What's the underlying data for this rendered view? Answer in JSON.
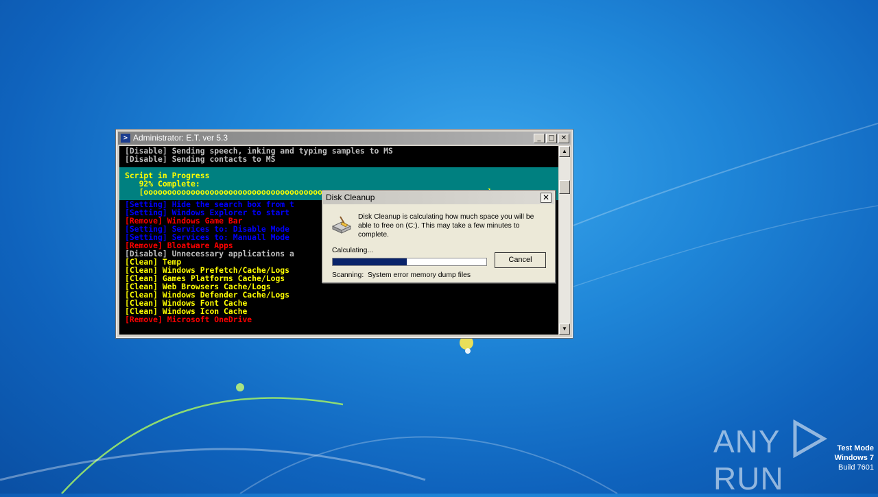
{
  "console": {
    "title": "Administrator: E.T. ver 5.3",
    "icon": "powershell-icon",
    "buttons": {
      "minimize": "_",
      "maximize": "□",
      "close": "✕"
    },
    "top_lines": [
      "[Disable] Sending speech, inking and typing samples to MS",
      "[Disable] Sending contacts to MS"
    ],
    "progress": {
      "title": "Script in Progress",
      "percent_text": "   92% Complete:",
      "bar_text": "   [oooooooooooooooooooooooooooooooooooooooooooooooooooooooooooooooooooooooo ]"
    },
    "lines": [
      {
        "text": "[Setting] Hide the search box from t",
        "color": "blue"
      },
      {
        "text": "[Setting] Windows Explorer to start",
        "color": "blue"
      },
      {
        "text": "[Remove] Windows Game Bar",
        "color": "red"
      },
      {
        "text": "[Setting] Services to: Disable Mode",
        "color": "blue"
      },
      {
        "text": "[Setting] Services to: Manuall Mode",
        "color": "blue"
      },
      {
        "text": "[Remove] Bloatware Apps",
        "color": "red"
      },
      {
        "text": "[Disable] Unnecessary applications a",
        "color": "gray"
      },
      {
        "text": "[Clean] Temp",
        "color": "yellow"
      },
      {
        "text": "[Clean] Windows Prefetch/Cache/Logs",
        "color": "yellow"
      },
      {
        "text": "[Clean] Games Platforms Cache/Logs",
        "color": "yellow"
      },
      {
        "text": "[Clean] Web Browsers Cache/Logs",
        "color": "yellow"
      },
      {
        "text": "[Clean] Windows Defender Cache/Logs",
        "color": "yellow"
      },
      {
        "text": "[Clean] Windows Font Cache",
        "color": "yellow"
      },
      {
        "text": "[Clean] Windows Icon Cache",
        "color": "yellow"
      },
      {
        "text": "[Remove] Microsoft OneDrive",
        "color": "red"
      }
    ]
  },
  "dialog": {
    "title": "Disk Cleanup",
    "close": "✕",
    "icon": "disk-cleanup-icon",
    "message": "Disk Cleanup is calculating how much space you will be able to free on  (C:). This may take a few minutes to complete.",
    "calculating_label": "Calculating...",
    "progress_fraction": 0.48,
    "cancel_label": "Cancel",
    "scanning_label": "Scanning:",
    "scanning_item": "System error memory dump files"
  },
  "watermark": {
    "text_left": "ANY",
    "text_right": "RUN"
  },
  "os_info": {
    "mode": "Test Mode",
    "os": "Windows 7",
    "build": "Build 7601"
  }
}
